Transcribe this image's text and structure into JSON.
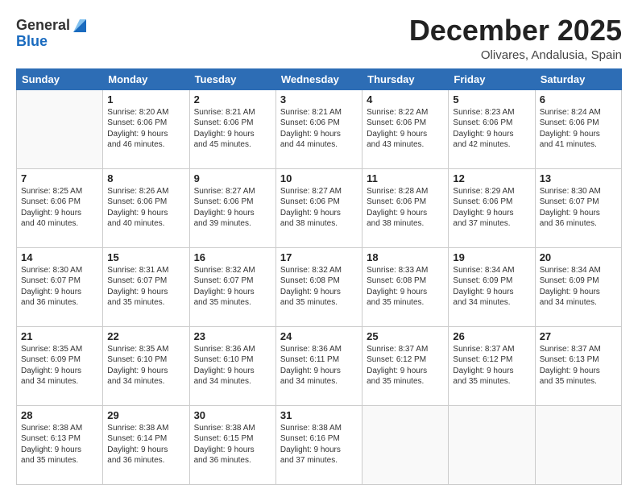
{
  "header": {
    "logo": {
      "general": "General",
      "blue": "Blue"
    },
    "month": "December 2025",
    "location": "Olivares, Andalusia, Spain"
  },
  "days_of_week": [
    "Sunday",
    "Monday",
    "Tuesday",
    "Wednesday",
    "Thursday",
    "Friday",
    "Saturday"
  ],
  "weeks": [
    [
      {
        "day": "",
        "info": ""
      },
      {
        "day": "1",
        "info": "Sunrise: 8:20 AM\nSunset: 6:06 PM\nDaylight: 9 hours\nand 46 minutes."
      },
      {
        "day": "2",
        "info": "Sunrise: 8:21 AM\nSunset: 6:06 PM\nDaylight: 9 hours\nand 45 minutes."
      },
      {
        "day": "3",
        "info": "Sunrise: 8:21 AM\nSunset: 6:06 PM\nDaylight: 9 hours\nand 44 minutes."
      },
      {
        "day": "4",
        "info": "Sunrise: 8:22 AM\nSunset: 6:06 PM\nDaylight: 9 hours\nand 43 minutes."
      },
      {
        "day": "5",
        "info": "Sunrise: 8:23 AM\nSunset: 6:06 PM\nDaylight: 9 hours\nand 42 minutes."
      },
      {
        "day": "6",
        "info": "Sunrise: 8:24 AM\nSunset: 6:06 PM\nDaylight: 9 hours\nand 41 minutes."
      }
    ],
    [
      {
        "day": "7",
        "info": "Sunrise: 8:25 AM\nSunset: 6:06 PM\nDaylight: 9 hours\nand 40 minutes."
      },
      {
        "day": "8",
        "info": "Sunrise: 8:26 AM\nSunset: 6:06 PM\nDaylight: 9 hours\nand 40 minutes."
      },
      {
        "day": "9",
        "info": "Sunrise: 8:27 AM\nSunset: 6:06 PM\nDaylight: 9 hours\nand 39 minutes."
      },
      {
        "day": "10",
        "info": "Sunrise: 8:27 AM\nSunset: 6:06 PM\nDaylight: 9 hours\nand 38 minutes."
      },
      {
        "day": "11",
        "info": "Sunrise: 8:28 AM\nSunset: 6:06 PM\nDaylight: 9 hours\nand 38 minutes."
      },
      {
        "day": "12",
        "info": "Sunrise: 8:29 AM\nSunset: 6:06 PM\nDaylight: 9 hours\nand 37 minutes."
      },
      {
        "day": "13",
        "info": "Sunrise: 8:30 AM\nSunset: 6:07 PM\nDaylight: 9 hours\nand 36 minutes."
      }
    ],
    [
      {
        "day": "14",
        "info": "Sunrise: 8:30 AM\nSunset: 6:07 PM\nDaylight: 9 hours\nand 36 minutes."
      },
      {
        "day": "15",
        "info": "Sunrise: 8:31 AM\nSunset: 6:07 PM\nDaylight: 9 hours\nand 35 minutes."
      },
      {
        "day": "16",
        "info": "Sunrise: 8:32 AM\nSunset: 6:07 PM\nDaylight: 9 hours\nand 35 minutes."
      },
      {
        "day": "17",
        "info": "Sunrise: 8:32 AM\nSunset: 6:08 PM\nDaylight: 9 hours\nand 35 minutes."
      },
      {
        "day": "18",
        "info": "Sunrise: 8:33 AM\nSunset: 6:08 PM\nDaylight: 9 hours\nand 35 minutes."
      },
      {
        "day": "19",
        "info": "Sunrise: 8:34 AM\nSunset: 6:09 PM\nDaylight: 9 hours\nand 34 minutes."
      },
      {
        "day": "20",
        "info": "Sunrise: 8:34 AM\nSunset: 6:09 PM\nDaylight: 9 hours\nand 34 minutes."
      }
    ],
    [
      {
        "day": "21",
        "info": "Sunrise: 8:35 AM\nSunset: 6:09 PM\nDaylight: 9 hours\nand 34 minutes."
      },
      {
        "day": "22",
        "info": "Sunrise: 8:35 AM\nSunset: 6:10 PM\nDaylight: 9 hours\nand 34 minutes."
      },
      {
        "day": "23",
        "info": "Sunrise: 8:36 AM\nSunset: 6:10 PM\nDaylight: 9 hours\nand 34 minutes."
      },
      {
        "day": "24",
        "info": "Sunrise: 8:36 AM\nSunset: 6:11 PM\nDaylight: 9 hours\nand 34 minutes."
      },
      {
        "day": "25",
        "info": "Sunrise: 8:37 AM\nSunset: 6:12 PM\nDaylight: 9 hours\nand 35 minutes."
      },
      {
        "day": "26",
        "info": "Sunrise: 8:37 AM\nSunset: 6:12 PM\nDaylight: 9 hours\nand 35 minutes."
      },
      {
        "day": "27",
        "info": "Sunrise: 8:37 AM\nSunset: 6:13 PM\nDaylight: 9 hours\nand 35 minutes."
      }
    ],
    [
      {
        "day": "28",
        "info": "Sunrise: 8:38 AM\nSunset: 6:13 PM\nDaylight: 9 hours\nand 35 minutes."
      },
      {
        "day": "29",
        "info": "Sunrise: 8:38 AM\nSunset: 6:14 PM\nDaylight: 9 hours\nand 36 minutes."
      },
      {
        "day": "30",
        "info": "Sunrise: 8:38 AM\nSunset: 6:15 PM\nDaylight: 9 hours\nand 36 minutes."
      },
      {
        "day": "31",
        "info": "Sunrise: 8:38 AM\nSunset: 6:16 PM\nDaylight: 9 hours\nand 37 minutes."
      },
      {
        "day": "",
        "info": ""
      },
      {
        "day": "",
        "info": ""
      },
      {
        "day": "",
        "info": ""
      }
    ]
  ]
}
